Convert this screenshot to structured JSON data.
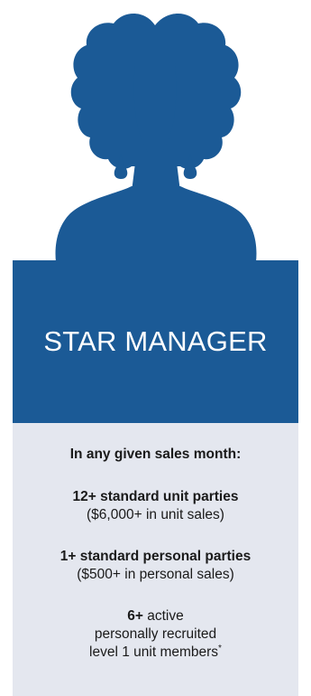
{
  "colors": {
    "brand_blue": "#1b5a96",
    "panel_grey": "#e4e7ef",
    "text_dark": "#1a1a1a",
    "text_light": "#ffffff"
  },
  "icon": "woman-silhouette-icon",
  "title": "STAR MANAGER",
  "requirements": {
    "intro": "In any given sales month:",
    "items": [
      {
        "highlight": "12+ standard unit parties",
        "rest": "",
        "detail": "($6,000+ in unit sales)"
      },
      {
        "highlight": "1+ standard personal parties",
        "rest": "",
        "detail": "($500+ in personal sales)"
      },
      {
        "highlight": "6+",
        "rest": " active",
        "detail": "personally recruited",
        "detail2": "level 1 unit members",
        "mark": "*"
      }
    ]
  }
}
